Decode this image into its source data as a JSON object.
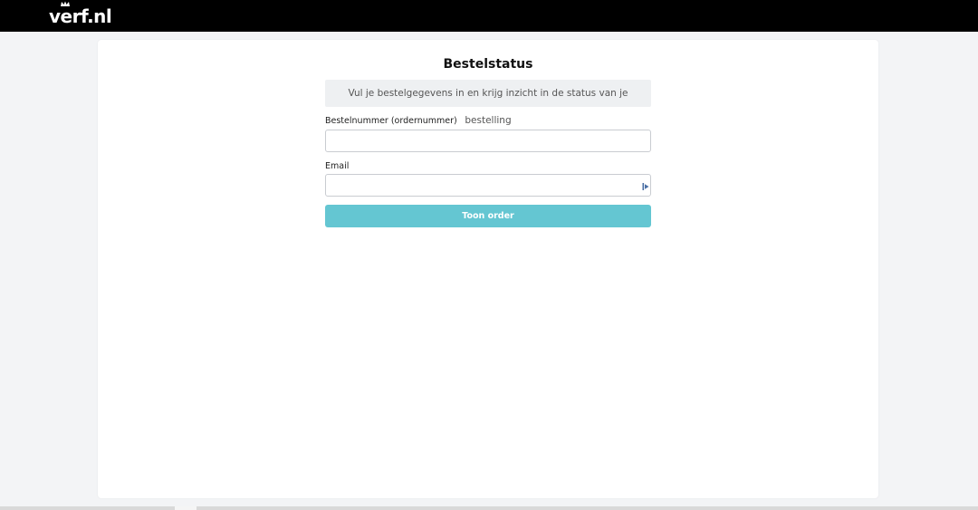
{
  "header": {
    "logo_text": "verf.nl",
    "background_color": "#000000"
  },
  "card": {
    "title": "Bestelstatus",
    "intro": "Vul je bestelgegevens in en krijg inzicht in de status van je bestelling",
    "order_field": {
      "label": "Bestelnummer (ordernummer)",
      "value": "",
      "placeholder": ""
    },
    "email_field": {
      "label": "Email",
      "value": "",
      "placeholder": "",
      "icon": "autofill-icon"
    },
    "submit_button": {
      "label": "Toon order",
      "color": "#64c6d2"
    }
  }
}
